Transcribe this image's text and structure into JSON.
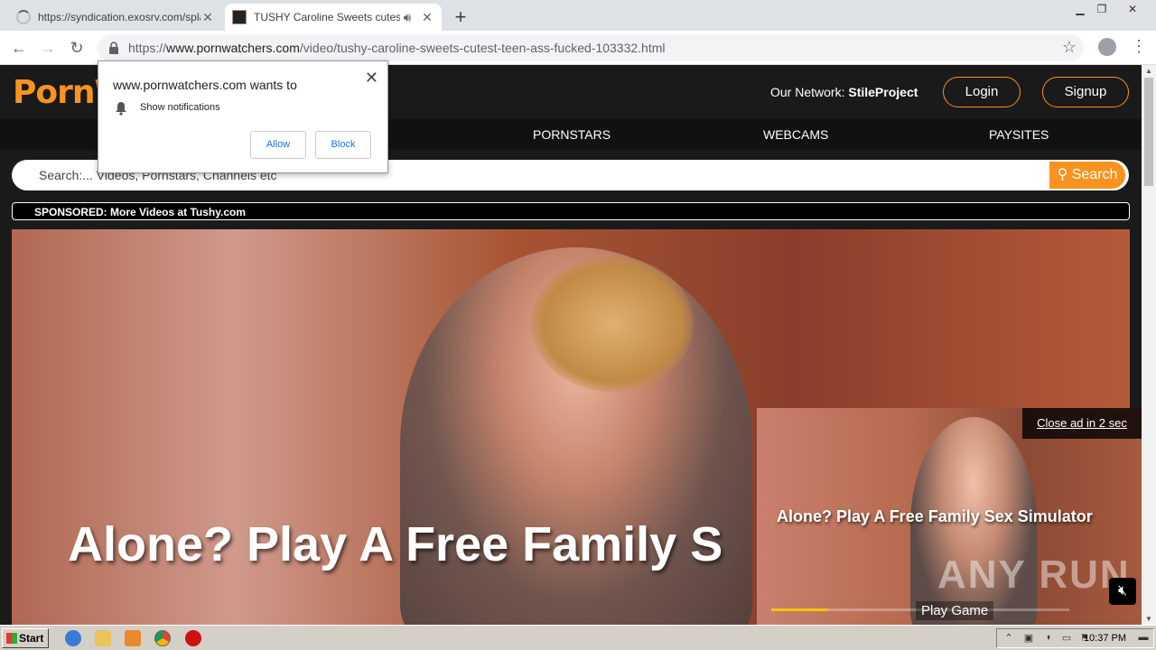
{
  "browser": {
    "tabs": [
      {
        "title": "https://syndication.exosrv.com/spla",
        "loading": true
      },
      {
        "title": "TUSHY Caroline Sweets cutest t",
        "active": true,
        "audio": true
      }
    ],
    "url_prefix": "https://",
    "url_host": "www.pornwatchers.com",
    "url_path": "/video/tushy-caroline-sweets-cutest-teen-ass-fucked-103332.html"
  },
  "notification": {
    "title": "www.pornwatchers.com wants to",
    "permission": "Show notifications",
    "allow": "Allow",
    "block": "Block"
  },
  "site": {
    "logo": "PornW",
    "network_label": "Our Network:",
    "network_name": "StileProject",
    "login": "Login",
    "signup": "Signup",
    "nav": [
      "PORNSTARS",
      "WEBCAMS",
      "PAYSITES"
    ],
    "search_placeholder": "Search:... Videos, Pornstars, Channels etc",
    "search_button": "Search",
    "sponsored": "SPONSORED: More Videos at Tushy.com",
    "video_headline": "Alone? Play A Free Family S"
  },
  "ad": {
    "close_text": "Close ad in 2 sec",
    "title": "Alone? Play A Free Family Sex Simulator",
    "cta": "Play Game",
    "watermark": "ANY RUN",
    "progress": 0.19
  },
  "taskbar": {
    "start": "Start",
    "clock": "10:37 PM"
  },
  "colors": {
    "accent": "#f7931e"
  }
}
